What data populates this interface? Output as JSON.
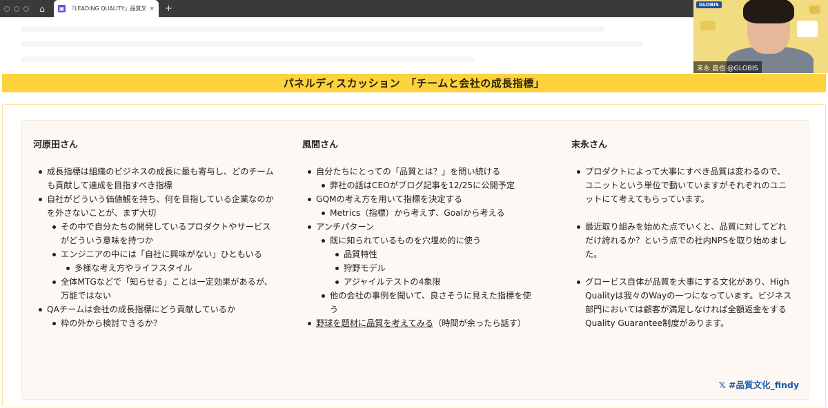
{
  "browser": {
    "tab_title": "『LEADING QUALITY』品質文化の",
    "tab_close": "×",
    "new_tab": "+",
    "home_icon": "⌂"
  },
  "banner": {
    "title": "パネルディスカッション　「チームと会社の成長指標」"
  },
  "columns": {
    "c1": {
      "heading": "河原田さん",
      "items": [
        "成長指標は組織のビジネスの成長に最も寄与し、どのチームも貢献して達成を目指すべき指標",
        "自社がどういう価値観を持ち、何を目指している企業なのかを外さないことが、まず大切",
        "その中で自分たちの開発しているプロダクトやサービスがどういう意味を持つか",
        "エンジニアの中には「自社に興味がない」ひともいる",
        "多様な考え方やライフスタイル",
        "全体MTGなどで「知らせる」ことは一定効果があるが、万能ではない",
        "QAチームは会社の成長指標にどう貢献しているか",
        "枠の外から検討できるか？"
      ]
    },
    "c2": {
      "heading": "風間さん",
      "items": [
        "自分たちにとっての「品質とは？」を問い続ける",
        "弊社の話はCEOがブログ記事を12/25に公開予定",
        "GQMの考え方を用いて指標を決定する",
        "Metrics（指標）から考えず、Goalから考える",
        "アンチパターン",
        "既に知られているものを穴埋め的に使う",
        "品質特性",
        "狩野モデル",
        "アジャイルテストの4象限",
        "他の会社の事例を聞いて、良さそうに見えた指標を使う",
        "野球を題材に品質を考えてみる",
        "（時間が余ったら話す）"
      ]
    },
    "c3": {
      "heading": "末永さん",
      "items": [
        "プロダクトによって大事にすべき品質は変わるので、ユニットという単位で動いていますがそれぞれのユニットにて考えてもらっています。",
        "最近取り組みを始めた点でいくと、品質に対してどれだけ誇れるか？という点での社内NPSを取り始めました。",
        "グロービス自体が品質を大事にする文化があり、High Qualityは我々のWayの一つになっています。ビジネス部門においては顧客が満足しなければ全額返金をするQuality Guarantee制度があります。"
      ]
    }
  },
  "hashtag": "𝕏 #品質文化_findy",
  "video": {
    "logo": "GLOBIS",
    "name": "末永 昌也 @GLOBIS"
  },
  "colors": {
    "banner": "#fdd23d",
    "panel_border": "#fbe39a",
    "hashtag": "#1d5aa6"
  }
}
